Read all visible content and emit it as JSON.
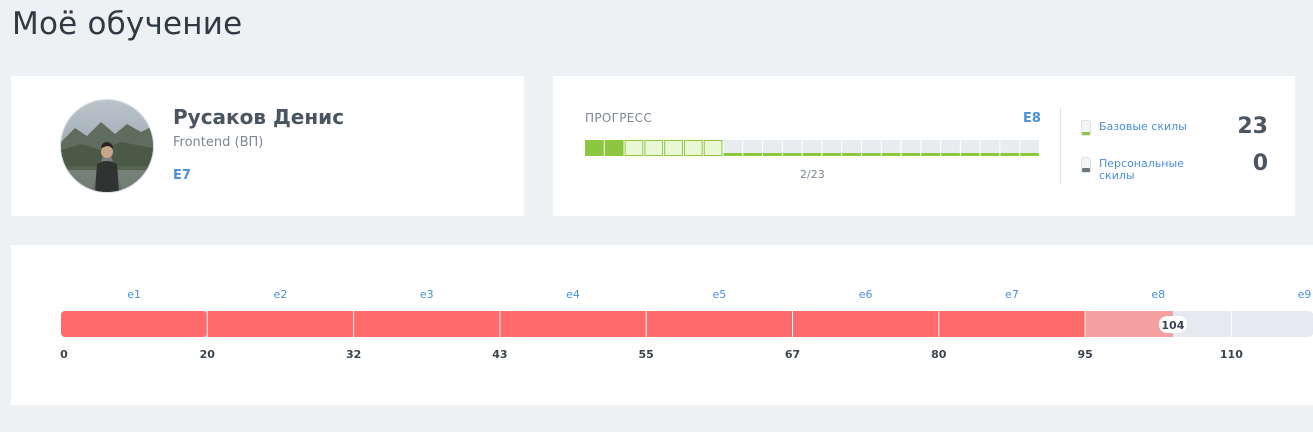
{
  "page": {
    "title": "Моё обучение"
  },
  "profile": {
    "name": "Русаков Денис",
    "role": "Frontend (ВП)",
    "level": "E7",
    "avatar_icon": "user-photo"
  },
  "progress": {
    "label": "ПРОГРЕСС",
    "target_level": "E8",
    "completed": 2,
    "total": 23,
    "highlighted": 7,
    "count_text": "2/23",
    "colors": {
      "done": "#8dc63f",
      "highlight": "#eaf7d5",
      "empty": "#e9ecef",
      "accent": "#4a90d9"
    }
  },
  "skills": [
    {
      "label": "Базовые скилы",
      "value": "23",
      "icon": "skill-bar-green-icon"
    },
    {
      "label": "Персональные скилы",
      "value": "0",
      "icon": "skill-bar-gray-icon"
    }
  ],
  "scale": {
    "levels": [
      "e1",
      "e2",
      "e3",
      "e4",
      "e5",
      "e6",
      "e7",
      "e8",
      "e9"
    ],
    "ticks": [
      "0",
      "20",
      "32",
      "43",
      "55",
      "67",
      "80",
      "95",
      "110"
    ],
    "tick_values": [
      0,
      20,
      32,
      43,
      55,
      67,
      80,
      95,
      110
    ],
    "current_value": 104,
    "current_label": "104",
    "reached_level_index": 7,
    "colors": {
      "filled": "#ff6b6b",
      "partial": "#f4a0a0",
      "empty": "#e6eaf0",
      "level_text": "#4a90d9"
    }
  }
}
